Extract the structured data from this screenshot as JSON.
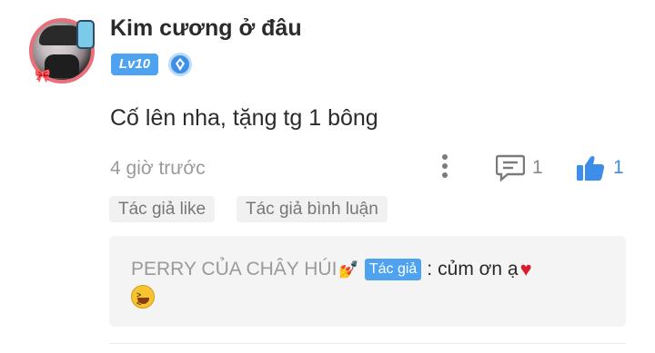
{
  "comment": {
    "username": "Kim cương ở đâu",
    "level": "Lv10",
    "text": "Cố lên nha, tặng tg 1 bông",
    "timestamp": "4 giờ trước",
    "reply_count": "1",
    "like_count": "1",
    "icons": {
      "more": "more-vertical-icon",
      "reply": "comment-icon",
      "like": "thumbs-up-icon",
      "rank": "rank-diamond-icon"
    }
  },
  "tags": {
    "author_like": "Tác giả like",
    "author_reply": "Tác giả bình luận"
  },
  "reply": {
    "author": "PERRY CỦA CHÂY HÚI",
    "author_emoji": "💅",
    "author_badge": "Tác giả",
    "separator": ":",
    "text": "củm ơn ạ",
    "heart": "♥"
  },
  "colors": {
    "accent": "#4ea3f0",
    "like": "#3d8ee8",
    "avatar_border": "#e96f7a",
    "heart": "#d81e2c"
  }
}
